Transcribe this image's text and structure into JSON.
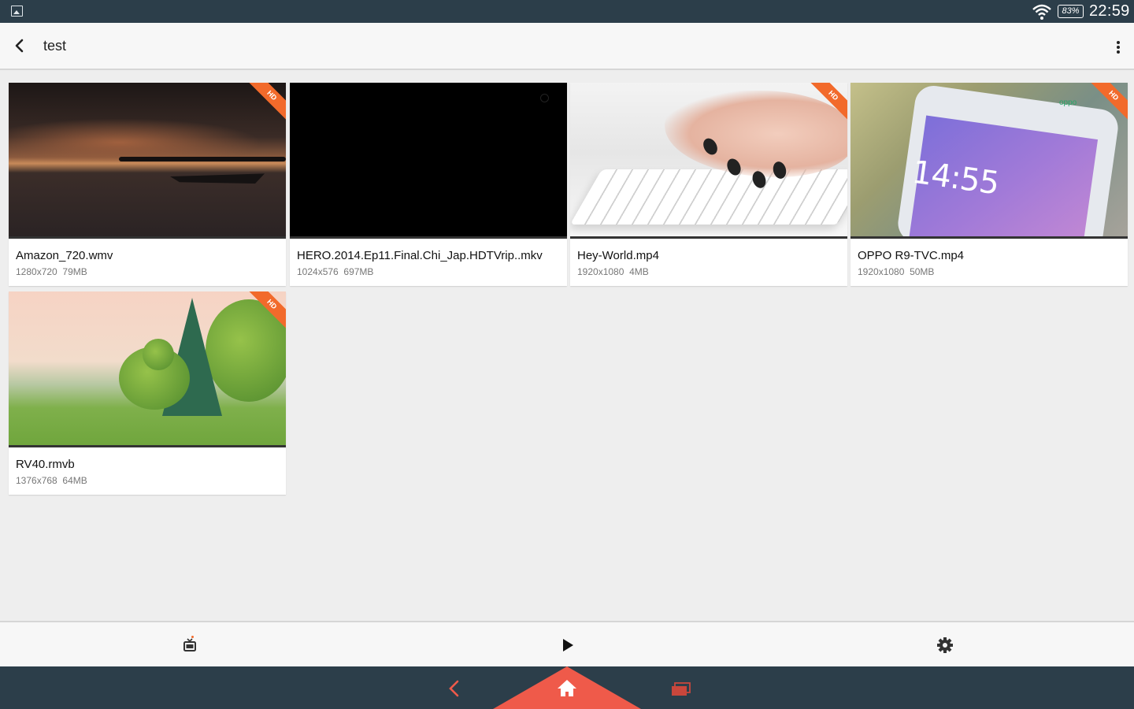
{
  "status_bar": {
    "battery": "83%",
    "time": "22:59",
    "icons": [
      "gallery-icon",
      "wifi-icon",
      "battery-icon"
    ]
  },
  "toolbar": {
    "title": "test",
    "icons": [
      "back-arrow-icon",
      "overflow-menu-icon"
    ]
  },
  "videos": [
    {
      "name": "Amazon_720.wmv",
      "resolution": "1280x720",
      "size": "79MB",
      "hd": "HD"
    },
    {
      "name": "HERO.2014.Ep11.Final.Chi_Jap.HDTVrip..mkv",
      "resolution": "1024x576",
      "size": "697MB",
      "hd": ""
    },
    {
      "name": "Hey-World.mp4",
      "resolution": "1920x1080",
      "size": "4MB",
      "hd": "HD"
    },
    {
      "name": "OPPO R9-TVC.mp4",
      "resolution": "1920x1080",
      "size": "50MB",
      "hd": "HD",
      "thumb_text": {
        "clock": "14:55",
        "brand": "oppo"
      }
    },
    {
      "name": "RV40.rmvb",
      "resolution": "1376x768",
      "size": "64MB",
      "hd": "HD"
    }
  ],
  "bottom_bar": {
    "icons": [
      "tv-icon",
      "play-icon",
      "settings-gear-icon"
    ]
  },
  "nav_bar": {
    "icons": [
      "nav-back-icon",
      "nav-home-icon",
      "nav-recents-icon"
    ]
  },
  "colors": {
    "status_bar": "#2c3e4a",
    "accent": "#ef5a4a",
    "hd_ribbon": "#f26a2b",
    "background": "#eeeeee"
  }
}
